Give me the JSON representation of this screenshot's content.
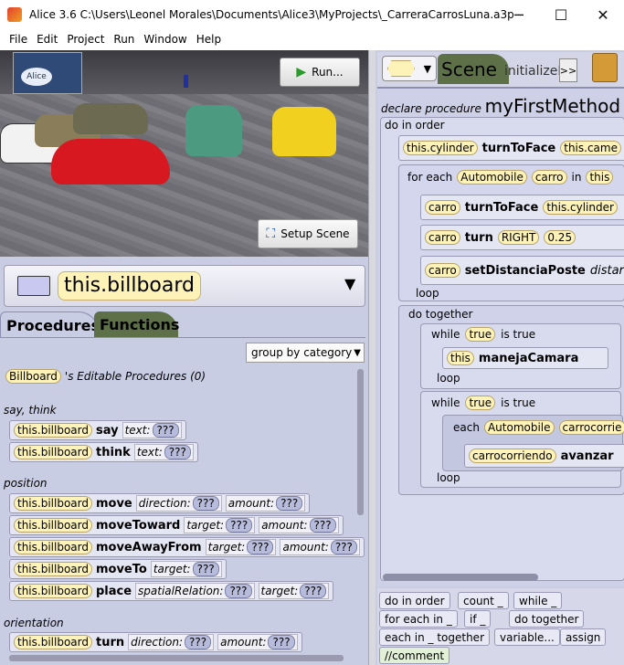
{
  "window": {
    "title": "Alice 3.6 C:\\Users\\Leonel Morales\\Documents\\Alice3\\MyProjects\\_CarreraCarrosLuna.a3p",
    "minimize": "─",
    "maximize": "☐",
    "close": "✕"
  },
  "menu": [
    "File",
    "Edit",
    "Project",
    "Run",
    "Window",
    "Help"
  ],
  "scene": {
    "logo_text": "Alice",
    "run_label": "Run...",
    "setup_label": "Setup Scene"
  },
  "selector": {
    "name": "this.billboard",
    "arrow": "▼"
  },
  "tabs": {
    "procedures": "Procedures",
    "functions": "Functions"
  },
  "group_by": "group by category",
  "editable": {
    "type": "Billboard",
    "suffix": "'s Editable Procedures (0)"
  },
  "categories": {
    "say_think": "say, think",
    "position": "position",
    "orientation": "orientation"
  },
  "procs": [
    {
      "obj": "this.billboard",
      "name": "say",
      "params": [
        {
          "label": "text:",
          "value": "???"
        }
      ]
    },
    {
      "obj": "this.billboard",
      "name": "think",
      "params": [
        {
          "label": "text:",
          "value": "???"
        }
      ]
    },
    {
      "obj": "this.billboard",
      "name": "move",
      "params": [
        {
          "label": "direction:",
          "value": "???"
        },
        {
          "label": "amount:",
          "value": "???"
        }
      ]
    },
    {
      "obj": "this.billboard",
      "name": "moveToward",
      "params": [
        {
          "label": "target:",
          "value": "???"
        },
        {
          "label": "amount:",
          "value": "???"
        }
      ]
    },
    {
      "obj": "this.billboard",
      "name": "moveAwayFrom",
      "params": [
        {
          "label": "target:",
          "value": "???"
        },
        {
          "label": "amount:",
          "value": "???"
        }
      ]
    },
    {
      "obj": "this.billboard",
      "name": "moveTo",
      "params": [
        {
          "label": "target:",
          "value": "???"
        }
      ]
    },
    {
      "obj": "this.billboard",
      "name": "place",
      "params": [
        {
          "label": "spatialRelation:",
          "value": "???"
        },
        {
          "label": "target:",
          "value": "???"
        }
      ]
    },
    {
      "obj": "this.billboard",
      "name": "turn",
      "params": [
        {
          "label": "direction:",
          "value": "???"
        },
        {
          "label": "amount:",
          "value": "???"
        }
      ]
    }
  ],
  "editor": {
    "scene_tab": "Scene",
    "init_tab": "initializeE",
    "more": ">>",
    "declare": "declare procedure",
    "method": "myFirstMethod",
    "do_in_order": "do in order",
    "stmt1": {
      "obj": "this.cylinder",
      "name": "turnToFace",
      "arg": "this.came"
    },
    "for_each": {
      "kw": "for each",
      "type": "Automobile",
      "var": "carro",
      "in": "in",
      "coll": "this"
    },
    "fe_stmts": [
      {
        "obj": "carro",
        "name": "turnToFace",
        "arg": "this.cylinder"
      },
      {
        "obj": "carro",
        "name": "turn",
        "arg": "RIGHT",
        "arg2": "0.25"
      },
      {
        "obj": "carro",
        "name": "setDistanciaPoste",
        "arg": "distar"
      }
    ],
    "loop": "loop",
    "do_together": "do together",
    "while1": {
      "kw": "while",
      "cond": "true",
      "is_true": "is true",
      "obj": "this",
      "name": "manejaCamara"
    },
    "while2": {
      "kw": "while",
      "cond": "true",
      "is_true": "is true"
    },
    "each": {
      "kw": "each",
      "type": "Automobile",
      "var": "carrocorrie",
      "inner_obj": "carrocorriendo",
      "inner_name": "avanzar"
    }
  },
  "palette": [
    "do in order",
    "count _",
    "while _",
    "for each in _",
    "if _",
    "do together",
    "each in _ together",
    "variable...",
    "assign",
    "//comment"
  ]
}
